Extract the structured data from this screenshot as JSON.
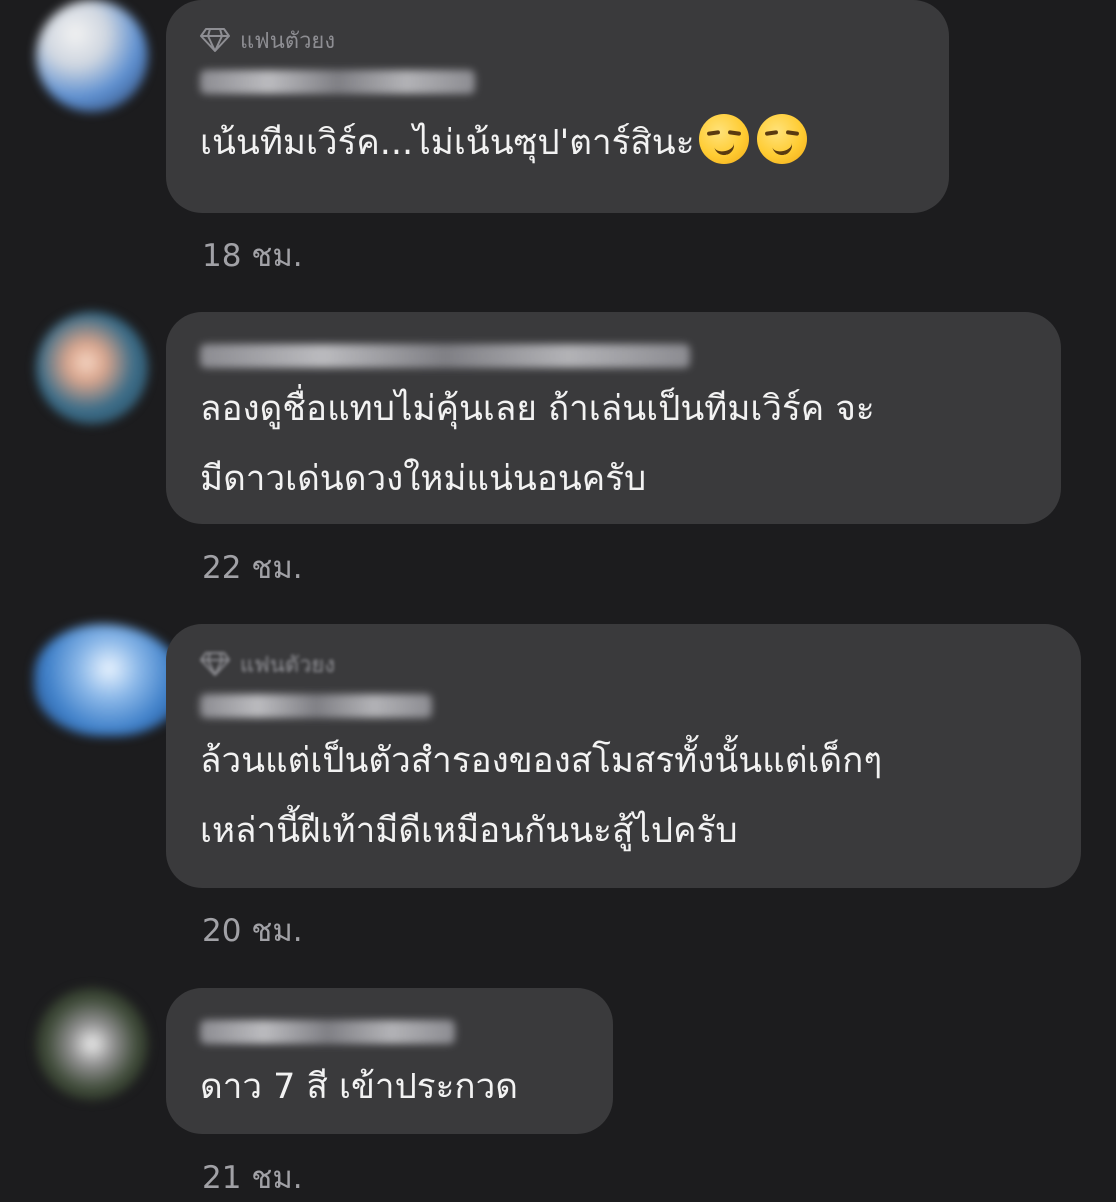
{
  "comments": [
    {
      "badge": "แฟนตัวยง",
      "text_lines": [
        "เน้นทีมเวิร์ค...ไม่เน้นซุป'ตาร์สินะ"
      ],
      "emoji": [
        "smirking-face",
        "smirking-face"
      ],
      "time": "18 ชม."
    },
    {
      "badge": "",
      "text_lines": [
        "ลองดูชื่อแทบไม่คุ้นเลย ถ้าเล่นเป็นทีมเวิร์ค จะ",
        "มีดาวเด่นดวงใหม่แน่นอนครับ"
      ],
      "time": "22 ชม."
    },
    {
      "badge": "แฟนตัวยง",
      "text_lines": [
        "ล้วนแต่เป็นตัวสำรองของสโมสรทั้งนั้นแต่เด็กๆ",
        "เหล่านี้ฝีเท้ามีดีเหมือนกันนะสู้ไปครับ"
      ],
      "time": "20 ชม."
    },
    {
      "badge": "",
      "text_lines": [
        "ดาว 7 สี เข้าประกวด"
      ],
      "time": "21 ชม."
    }
  ],
  "colors": {
    "background": "#1c1c1e",
    "bubble": "#3a3a3c",
    "text": "#f2f2f2",
    "muted": "#a1a1a6"
  }
}
